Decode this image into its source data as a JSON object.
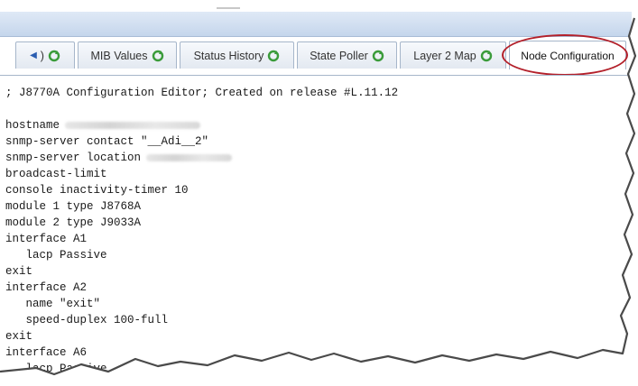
{
  "tabs": [
    {
      "label": ")"
    },
    {
      "label": "MIB Values"
    },
    {
      "label": "Status History"
    },
    {
      "label": "State Poller"
    },
    {
      "label": "Layer 2 Map"
    },
    {
      "label": "Node Configuration",
      "active": true
    }
  ],
  "icons": {
    "refresh": "refresh-icon",
    "nav": "left-arrow-icon"
  },
  "colors": {
    "highlight": "#b3202a",
    "header": "#c5d6ec"
  },
  "config_lines": [
    "; J8770A Configuration Editor; Created on release #L.11.12",
    "",
    "hostname",
    "snmp-server contact \"__Adi__2\"",
    "snmp-server location",
    "broadcast-limit",
    "console inactivity-timer 10",
    "module 1 type J8768A",
    "module 2 type J9033A",
    "interface A1",
    "   lacp Passive",
    "exit",
    "interface A2",
    "   name \"exit\"",
    "   speed-duplex 100-full",
    "exit",
    "interface A6",
    "   lacp Passive"
  ]
}
